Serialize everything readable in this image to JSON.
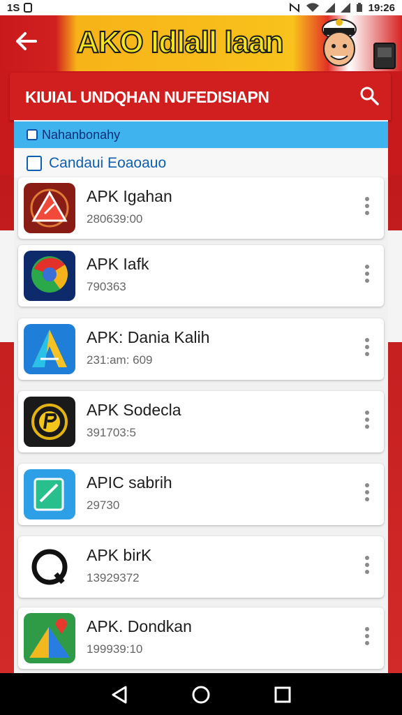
{
  "status": {
    "left": "1S",
    "time": "19:26"
  },
  "banner": {
    "title": "AKO Idlall laan"
  },
  "header": {
    "title": "KIUIAL UNDQHAN NUFEDISIAPN"
  },
  "filters": [
    {
      "label": "Nahanbonahy"
    },
    {
      "label": "Candaui Eoaoauo"
    }
  ],
  "apps": [
    {
      "name": "APK Igahan",
      "meta": "280639:00"
    },
    {
      "name": "APK Iafk",
      "meta": "790363"
    },
    {
      "name": "APK: Dania Kalih",
      "meta": "231:am: 609"
    },
    {
      "name": "APK Sodecla",
      "meta": "391703:5"
    },
    {
      "name": "APIC sabrih",
      "meta": "29730"
    },
    {
      "name": "APK birK",
      "meta": "13929372"
    },
    {
      "name": "APK. Dondkan",
      "meta": "199939:10"
    }
  ],
  "colors": {
    "accent_red": "#d11f1f",
    "filter_blue": "#3fb3ee",
    "banner_yellow": "#f9c21c"
  },
  "icons": {
    "back": "arrow-left-icon",
    "search": "search-icon",
    "more": "more-vertical-icon",
    "nav": [
      "back-triangle-icon",
      "home-circle-icon",
      "recents-square-icon"
    ]
  }
}
